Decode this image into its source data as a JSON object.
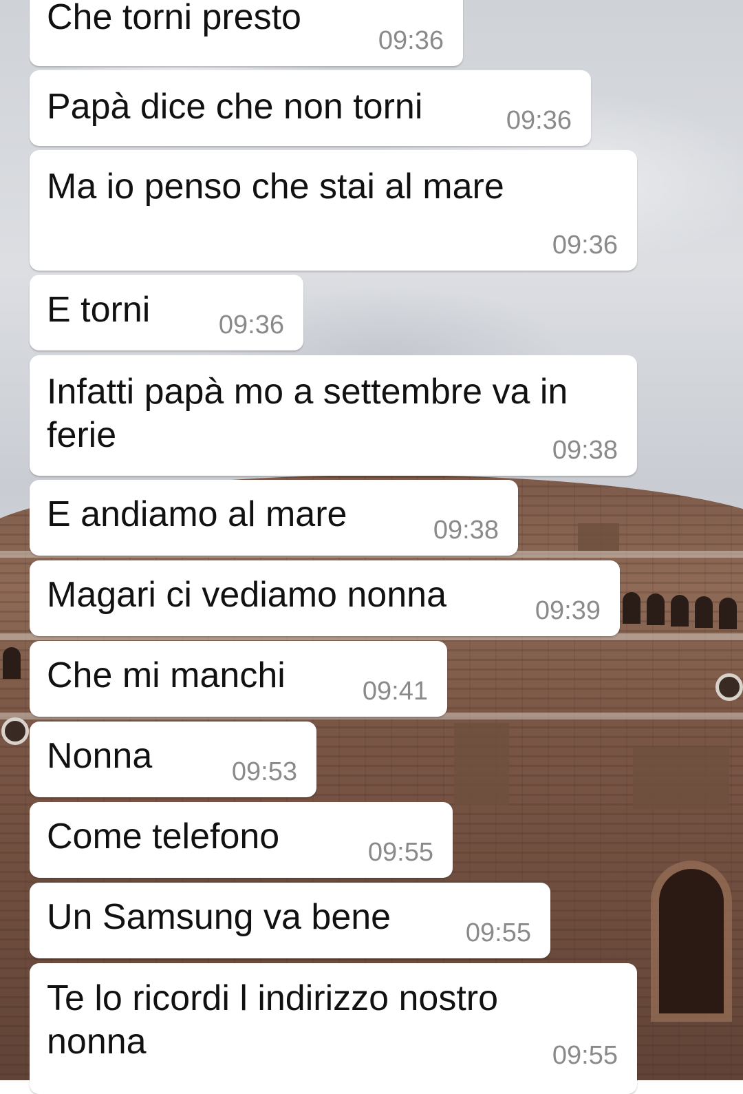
{
  "messages": [
    {
      "text": "Che torni presto",
      "time": "09:36"
    },
    {
      "text": "Papà dice che non torni",
      "time": "09:36"
    },
    {
      "text": "Ma io penso che stai al mare",
      "time": "09:36"
    },
    {
      "text": "E torni",
      "time": "09:36"
    },
    {
      "text": "Infatti papà mo a settembre va in ferie",
      "time": "09:38"
    },
    {
      "text": "E andiamo al mare",
      "time": "09:38"
    },
    {
      "text": "Magari ci vediamo nonna",
      "time": "09:39"
    },
    {
      "text": "Che mi manchi",
      "time": "09:41"
    },
    {
      "text": "Nonna",
      "time": "09:53"
    },
    {
      "text": "Come telefono",
      "time": "09:55"
    },
    {
      "text": "Un Samsung va bene",
      "time": "09:55"
    },
    {
      "text": "Te lo ricordi l indirizzo nostro nonna",
      "time": "09:55"
    }
  ]
}
